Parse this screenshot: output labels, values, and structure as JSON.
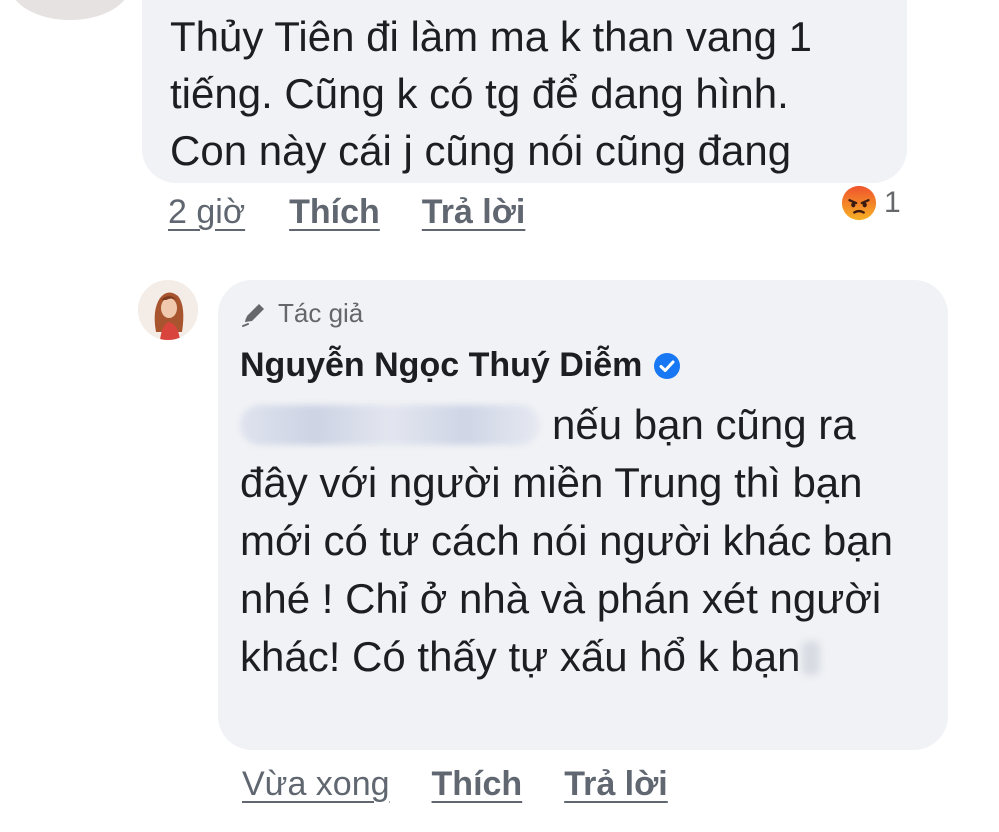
{
  "top_comment": {
    "text": "Thủy Tiên đi làm ma k than vang 1\ntiếng. Cũng k có tg để dang hình.\nCon này cái j cũng nói cũng đang",
    "time": "2 giờ",
    "like_label": "Thích",
    "reply_label": "Trả lời",
    "reaction": {
      "icon": "angry-reaction-icon",
      "count": "1"
    }
  },
  "reply_comment": {
    "author_badge": "Tác giả",
    "author_name": "Nguyễn Ngọc Thuý Diễm",
    "text_line1": "nếu bạn cũng ra",
    "text_rest": "đây với người miền Trung thì bạn mới có tư cách nói người khác bạn nhé ! Chỉ ở nhà và phán xét người khác! Có thấy tự xấu hổ k bạn",
    "time": "Vừa xong",
    "like_label": "Thích",
    "reply_label": "Trả lời"
  },
  "colors": {
    "bubble": "#f0f2f5",
    "text": "#1c1e21",
    "secondary_text": "#65676b",
    "verified_blue": "#1877f2",
    "angry_top": "#f0542d",
    "angry_bottom": "#f7b125"
  }
}
